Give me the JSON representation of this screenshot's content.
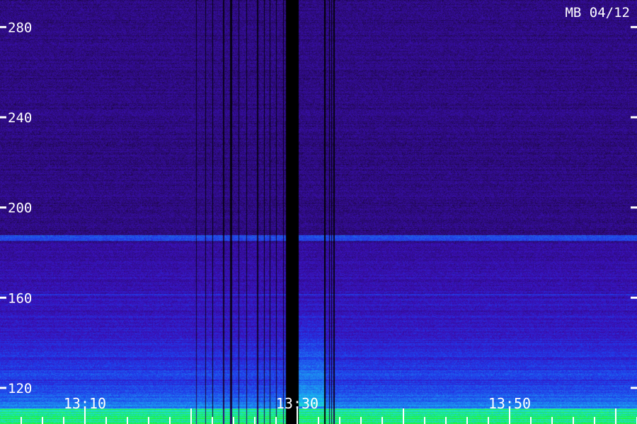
{
  "chart_data": {
    "type": "heatmap",
    "title": "MB 04/12",
    "y_ticks": [
      120,
      160,
      200,
      240,
      280
    ],
    "y_tick_labels": [
      "120",
      "160",
      "200",
      "240",
      "280"
    ],
    "ylim": [
      104,
      292
    ],
    "x_tick_labels": [
      "13:10",
      "13:30",
      "13:50"
    ],
    "x_tick_times": [
      10,
      30,
      50
    ],
    "xlim": [
      2,
      62
    ],
    "colormap": [
      "#000000",
      "#2a0a6e",
      "#3a10b8",
      "#2038e8",
      "#1e78f0",
      "#18b8f0",
      "#20e8c0",
      "#18f048",
      "#40ff10"
    ],
    "features": {
      "gap_band": [
        28.9,
        30.1
      ],
      "narrow_gap": [
        32.5,
        32.6
      ],
      "bright_line_mhz": 186.5,
      "line_160_mhz": 161.5,
      "line_152_mhz": 152,
      "green_floor_mhz": 111
    },
    "grid": false,
    "legend": "none"
  }
}
